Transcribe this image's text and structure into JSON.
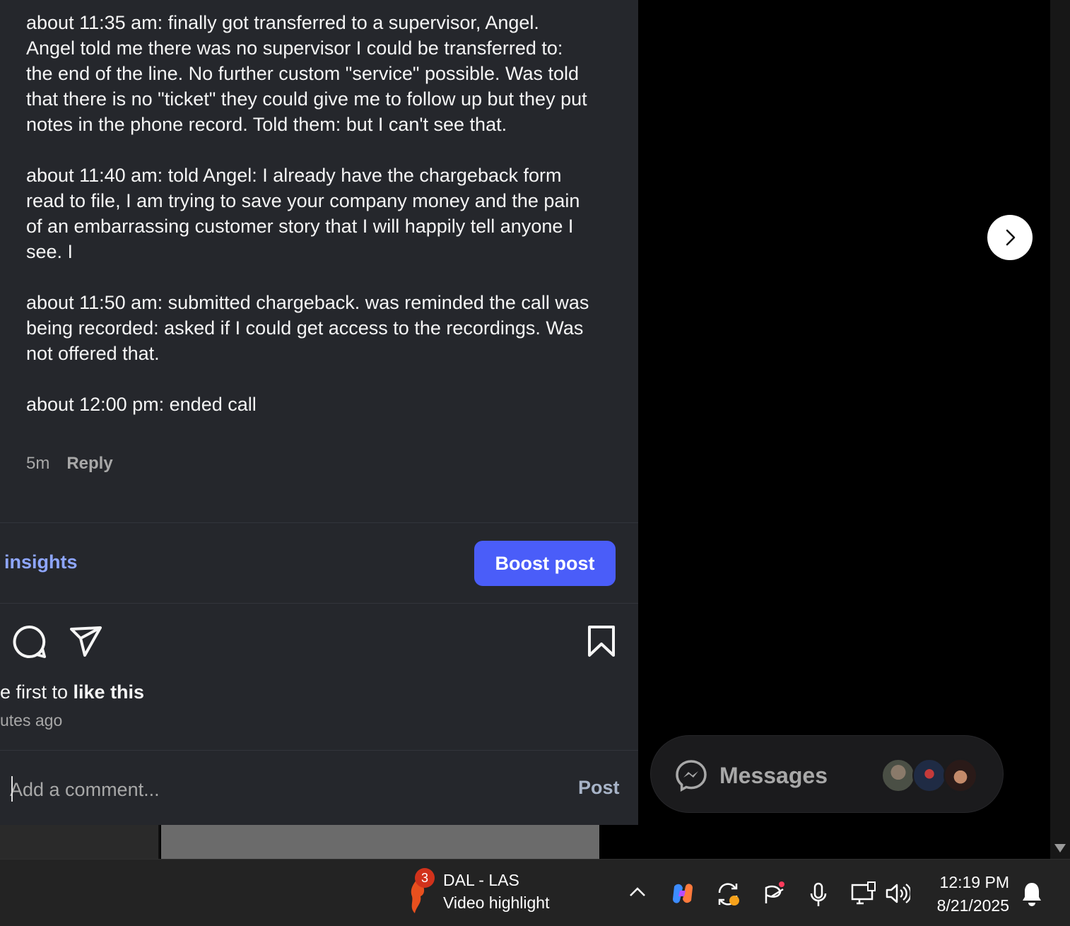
{
  "comment": {
    "paragraphs": [
      "about 11:35 am: finally got transferred to a supervisor, Angel. Angel told me there was no supervisor I could be transferred to: the end of the line. No further custom \"service\" possible. Was told that there is no \"ticket\" they could give me to follow up but they put notes in the phone record. Told them: but I can't see that.",
      "about 11:40 am: told Angel: I already have the chargeback form read to file, I am trying to save your company money and the pain of an embarrassing customer story that I will happily tell anyone I see. I",
      "about 11:50 am: submitted chargeback. was reminded the call was being recorded: asked if I could get access to the recordings. Was not offered that.",
      "about 12:00 pm: ended call"
    ],
    "time": "5m",
    "reply_label": "Reply"
  },
  "post": {
    "insights_label": "insights",
    "boost_label": "Boost post",
    "likes_prefix": "e first to ",
    "likes_bold": "like this",
    "time_ago": "utes ago",
    "comment_placeholder": "Add a comment...",
    "post_label": "Post"
  },
  "messages": {
    "label": "Messages"
  },
  "taskbar": {
    "widget_badge": "3",
    "widget_title": "DAL - LAS",
    "widget_subtitle": "Video highlight",
    "time": "12:19 PM",
    "date": "8/21/2025"
  },
  "colors": {
    "panel_bg": "#25272c",
    "boost_blue": "#4a5df9",
    "insights_blue": "#8ea6ff",
    "badge_red": "#d1321b"
  }
}
